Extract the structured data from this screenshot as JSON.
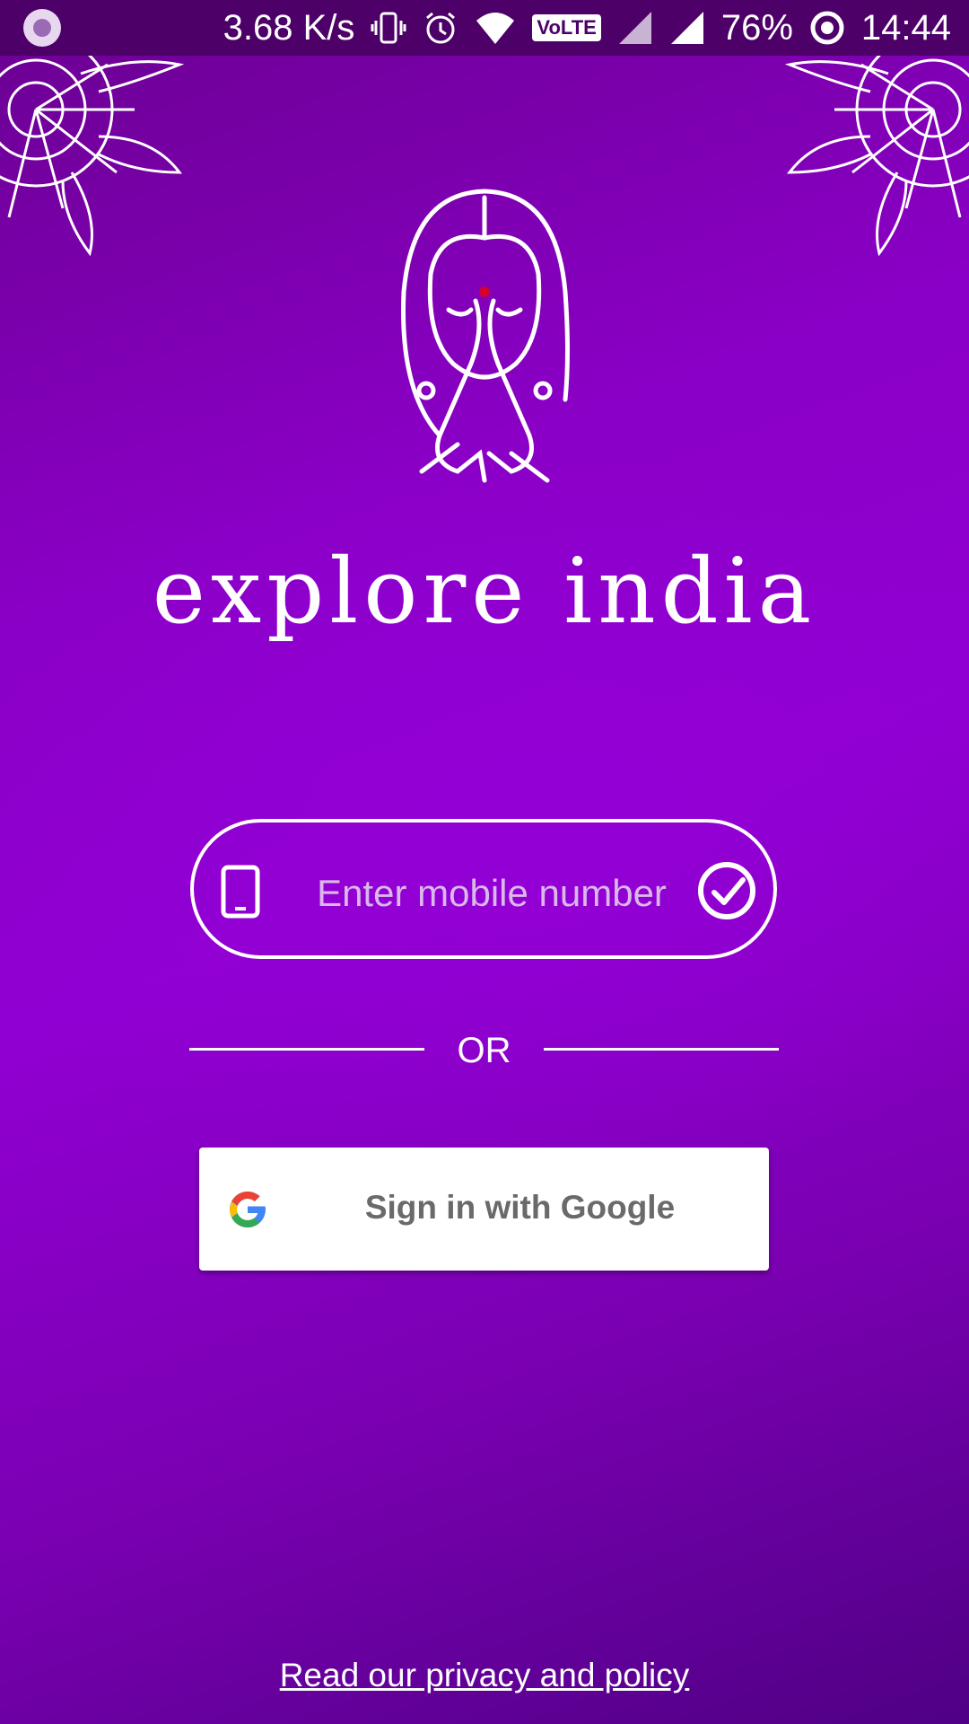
{
  "status_bar": {
    "net_speed": "3.68 K/s",
    "volte_label": "VoLTE",
    "battery": "76%",
    "time": "14:44"
  },
  "app": {
    "brand": "explore india"
  },
  "login": {
    "mobile_placeholder": "Enter mobile number",
    "or_label": "OR",
    "google_button_label": "Sign in with Google",
    "privacy_link": "Read our privacy and policy"
  },
  "colors": {
    "background_purple": "#9100d2",
    "status_bar": "#4c0068",
    "accent_white": "#ffffff"
  },
  "icons": [
    "phone-icon",
    "check-circle-icon",
    "google-icon",
    "namaste-logo",
    "mandala-ornament"
  ]
}
